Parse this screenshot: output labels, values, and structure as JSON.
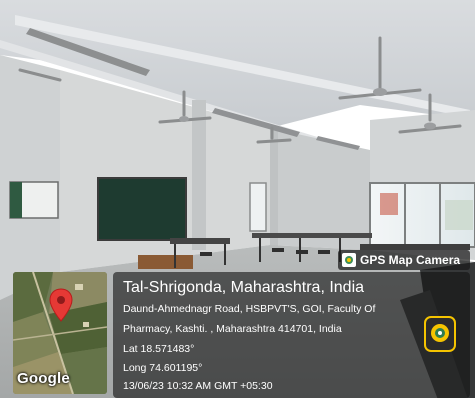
{
  "overlay": {
    "app_badge": "GPS Map Camera",
    "location_title": "Tal-Shrigonda, Maharashtra, India",
    "address_line1": "Daund-Ahmednagr Road, HSBPVT'S, GOI, Faculty Of",
    "address_line2": "Pharmacy, Kashti. , Maharashtra 414701, India",
    "latitude": "Lat 18.571483°",
    "longitude": "Long 74.601195°",
    "timestamp": "13/06/23 10:32 AM GMT +05:30",
    "map_brand": "Google"
  },
  "icons": [
    "map-pin-icon",
    "gps-camera-app-icon",
    "badge-camera-icon"
  ],
  "colors": {
    "pin_red": "#e53935",
    "panel_bg": "#141414",
    "app_yellow": "#f5c400"
  }
}
